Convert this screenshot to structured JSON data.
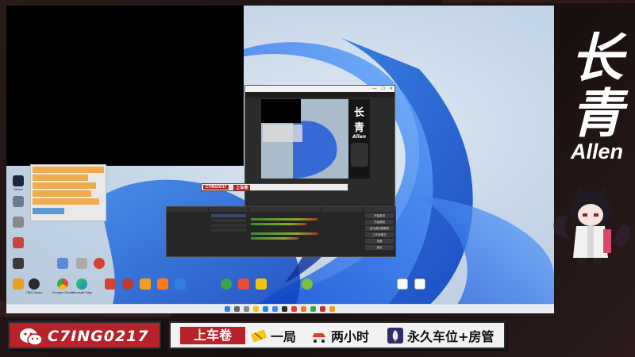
{
  "desktop": {
    "icons": [
      {
        "name": "steam-icon",
        "label": "Steam",
        "color": "#1b2838"
      },
      {
        "name": "app-icon-2",
        "label": "",
        "color": "#6b7b8b"
      },
      {
        "name": "app-icon-3",
        "label": "",
        "color": "#c9463a"
      },
      {
        "name": "app-icon-4",
        "label": "",
        "color": "#888888"
      },
      {
        "name": "app-icon-5",
        "label": "",
        "color": "#3a3a3a"
      },
      {
        "name": "app-icon-6",
        "label": "",
        "color": "#e8a020"
      },
      {
        "name": "obs-studio-icon",
        "label": "OBS Studio",
        "color": "#2b2b2b"
      },
      {
        "name": "app-icon-8",
        "label": "",
        "color": "#d9402f"
      },
      {
        "name": "app-icon-9",
        "label": "",
        "color": "#d9402f"
      },
      {
        "name": "chrome-icon",
        "label": "Google Chrome",
        "color": "#4285f4"
      },
      {
        "name": "edge-icon",
        "label": "Microsoft Edge",
        "color": "#1f8bd6"
      }
    ],
    "file_icons": [
      {
        "name": "file-icon-1",
        "label": ""
      },
      {
        "name": "file-icon-2",
        "label": ""
      }
    ]
  },
  "obs": {
    "title_buttons": [
      "—",
      "☐",
      "✕"
    ],
    "preview_char1": "长",
    "preview_char2": "青",
    "preview_name": "Allen",
    "preview_wechat": "C7ING0217",
    "preview_promo": "上车卷",
    "controls": [
      "开始推流",
      "开始录制",
      "启动虚拟摄像机",
      "工作室模式",
      "设置",
      "退出"
    ]
  },
  "branding": {
    "char1": "长",
    "char2": "青",
    "name": "Allen"
  },
  "bottom_bar": {
    "wechat_id": "C7ING0217",
    "ticket_label": "上车卷",
    "promos": [
      {
        "text": "一局",
        "icon": "ticket-icon"
      },
      {
        "text": "两小时",
        "icon": "car-icon"
      },
      {
        "text": "永久车位+房管",
        "icon": "rocket-icon"
      }
    ]
  },
  "colors": {
    "accent_red": "#b8222a",
    "bg_dark": "#241717",
    "promo_bg": "#f2f2f2"
  }
}
